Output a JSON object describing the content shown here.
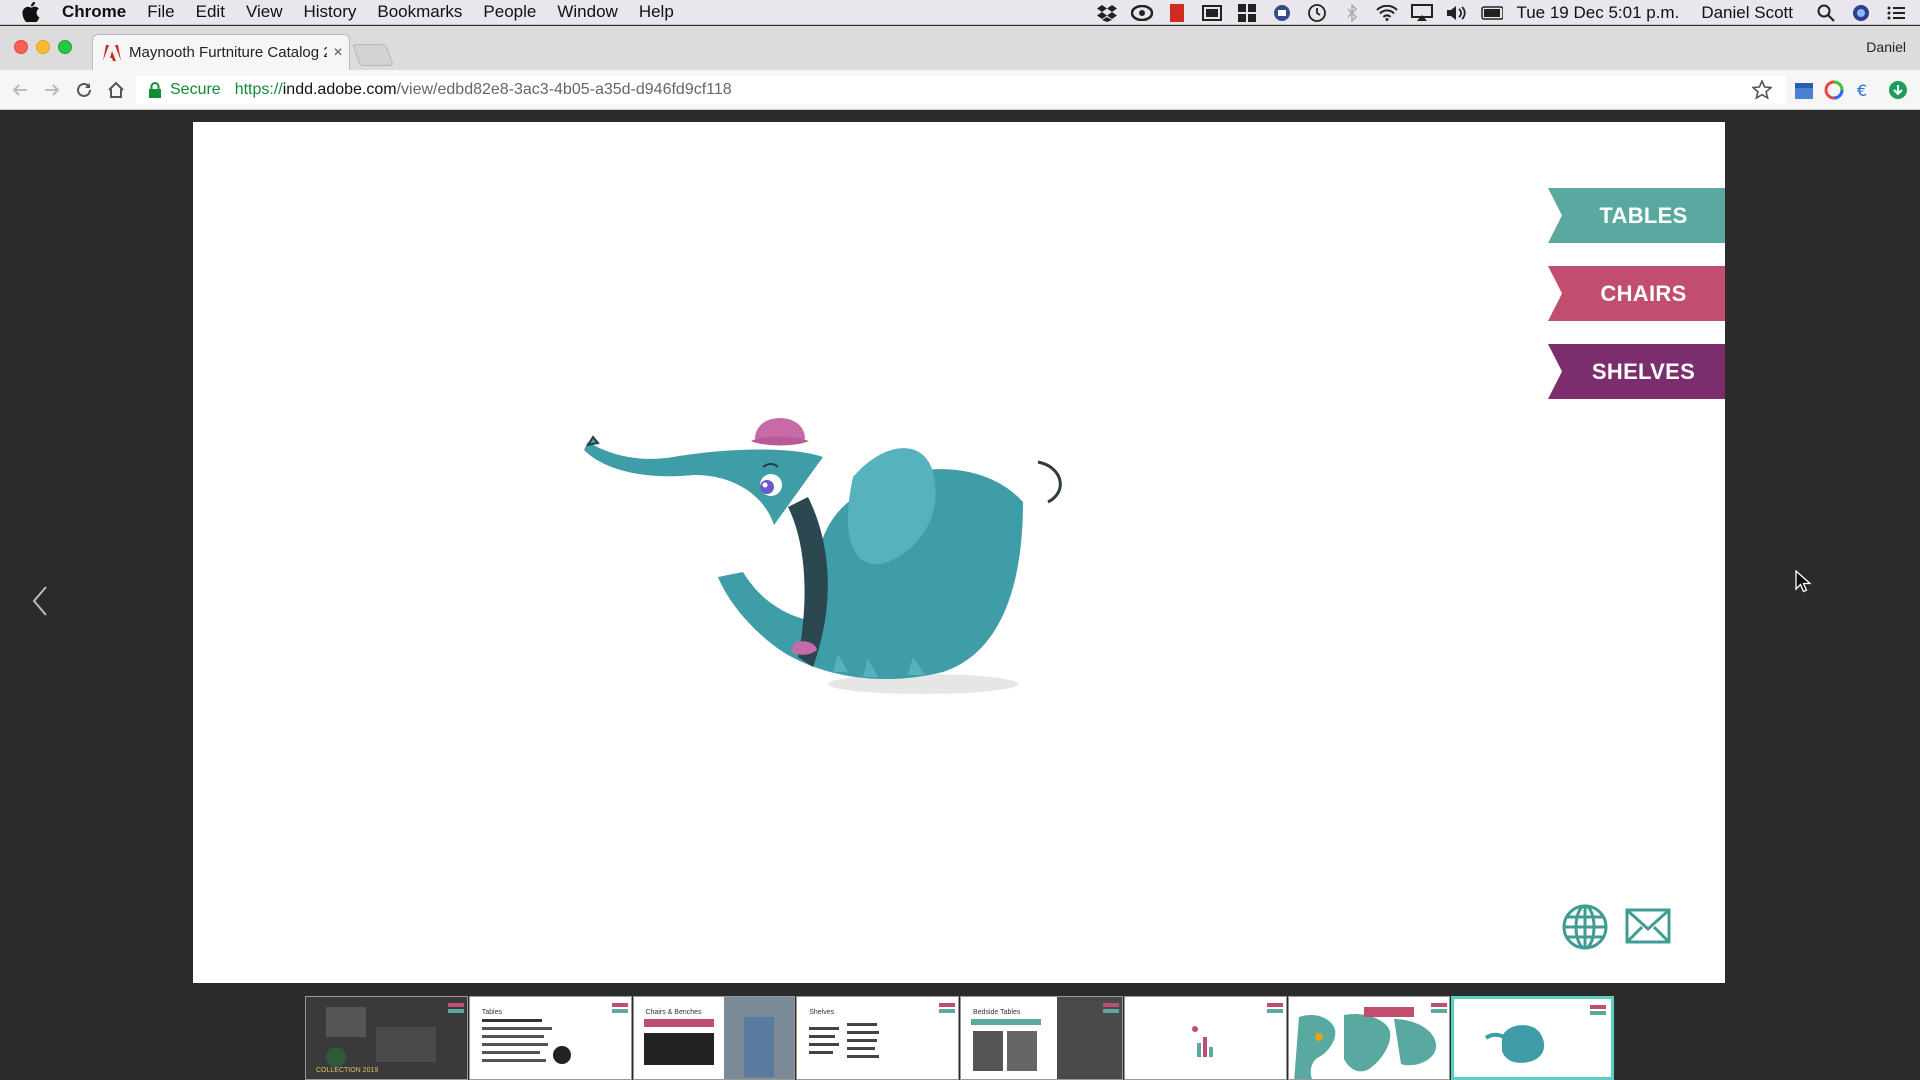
{
  "menubar": {
    "app_name": "Chrome",
    "menus": [
      "File",
      "Edit",
      "View",
      "History",
      "Bookmarks",
      "People",
      "Window",
      "Help"
    ],
    "clock": "Tue 19 Dec  5:01 p.m.",
    "user": "Daniel Scott"
  },
  "tabbar": {
    "tab_title": "Maynooth Furtniture Catalog 2",
    "profile_name": "Daniel"
  },
  "omnibox": {
    "secure_label": "Secure",
    "url_scheme": "https://",
    "url_host": "indd.adobe.com",
    "url_path": "/view/edbd82e8-3ac3-4b05-a35d-d946fd9cf118"
  },
  "page": {
    "nav": [
      {
        "label": "TABLES",
        "color": "#5aa9a0"
      },
      {
        "label": "CHAIRS",
        "color": "#c14e6e"
      },
      {
        "label": "SHELVES",
        "color": "#7b2d6d"
      }
    ],
    "accent_color": "#3f9c95"
  },
  "thumbnails": [
    {
      "label": "COLLECTION 2019",
      "active": false
    },
    {
      "label": "Tables",
      "active": false
    },
    {
      "label": "Chairs & Benches",
      "active": false
    },
    {
      "label": "Shelves",
      "active": false
    },
    {
      "label": "Bedside Tables",
      "active": false
    },
    {
      "label": "",
      "active": false
    },
    {
      "label": "",
      "active": false
    },
    {
      "label": "",
      "active": true
    }
  ]
}
